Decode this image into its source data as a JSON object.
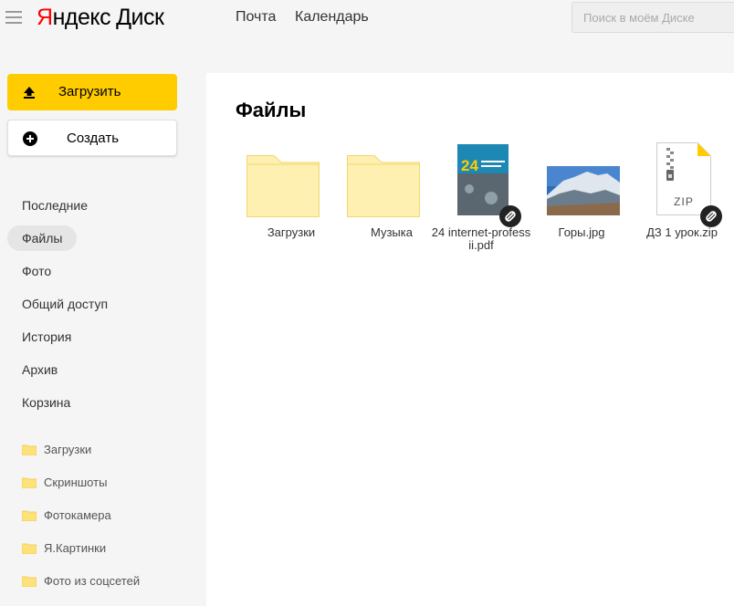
{
  "header": {
    "logo_ya": "Я",
    "logo_ndex": "ндекс",
    "logo_disk": "Диск",
    "links": [
      "Почта",
      "Календарь"
    ],
    "search_placeholder": "Поиск в моём Диске"
  },
  "sidebar": {
    "upload_label": "Загрузить",
    "create_label": "Создать",
    "nav": [
      "Последние",
      "Файлы",
      "Фото",
      "Общий доступ",
      "История",
      "Архив",
      "Корзина"
    ],
    "active_nav": "Файлы",
    "folders": [
      "Загрузки",
      "Скриншоты",
      "Фотокамера",
      "Я.Картинки",
      "Фото из соцсетей"
    ]
  },
  "main": {
    "title": "Файлы",
    "items": [
      {
        "name": "Загрузки",
        "type": "folder"
      },
      {
        "name": "Музыка",
        "type": "folder"
      },
      {
        "name": "24 internet-professii.pdf",
        "type": "pdf",
        "shared": true
      },
      {
        "name": "Горы.jpg",
        "type": "image"
      },
      {
        "name": "ДЗ 1 урок.zip",
        "type": "zip",
        "shared": true
      }
    ],
    "pdf_cover_number": "24",
    "zip_badge": "ZIP"
  },
  "colors": {
    "accent": "#ffcc00",
    "logo_red": "#ff0000",
    "folder": "#fdf0b0",
    "folder_border": "#f3d76b"
  }
}
